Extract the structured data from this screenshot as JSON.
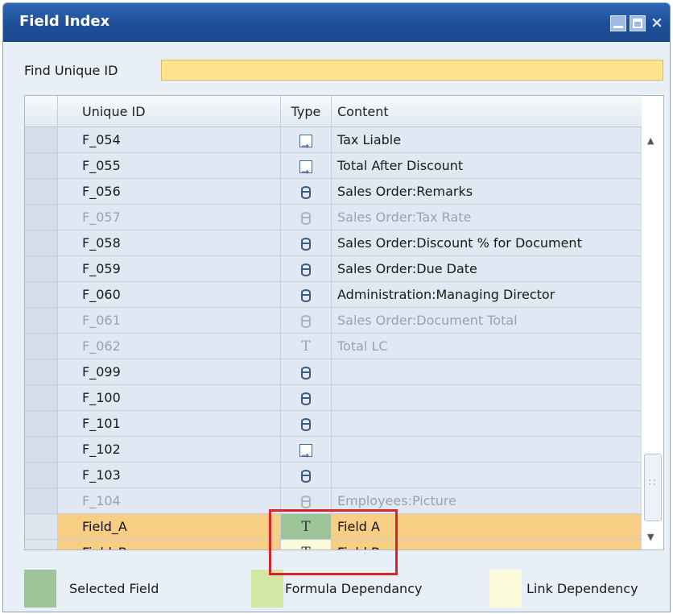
{
  "window": {
    "title": "Field Index"
  },
  "find": {
    "label": "Find Unique ID",
    "value": ""
  },
  "grid": {
    "headers": {
      "unique_id": "Unique ID",
      "type": "Type",
      "content": "Content"
    },
    "rows": [
      {
        "id": "F_054",
        "type_icon": "link-icon",
        "content": "Tax Liable",
        "state": "normal"
      },
      {
        "id": "F_055",
        "type_icon": "link-icon",
        "content": "Total After Discount",
        "state": "normal"
      },
      {
        "id": "F_056",
        "type_icon": "database-icon",
        "content": "Sales Order:Remarks",
        "state": "normal"
      },
      {
        "id": "F_057",
        "type_icon": "database-icon",
        "content": "Sales Order:Tax Rate",
        "state": "disabled"
      },
      {
        "id": "F_058",
        "type_icon": "database-icon",
        "content": "Sales Order:Discount % for Document",
        "state": "normal"
      },
      {
        "id": "F_059",
        "type_icon": "database-icon",
        "content": "Sales Order:Due Date",
        "state": "normal"
      },
      {
        "id": "F_060",
        "type_icon": "database-icon",
        "content": "Administration:Managing Director",
        "state": "normal"
      },
      {
        "id": "F_061",
        "type_icon": "database-icon",
        "content": "Sales Order:Document Total",
        "state": "disabled"
      },
      {
        "id": "F_062",
        "type_icon": "text-icon",
        "type_glyph": "T",
        "content": "Total LC",
        "state": "disabled"
      },
      {
        "id": "F_099",
        "type_icon": "database-icon",
        "content": "",
        "state": "normal"
      },
      {
        "id": "F_100",
        "type_icon": "database-icon",
        "content": "",
        "state": "normal"
      },
      {
        "id": "F_101",
        "type_icon": "database-icon",
        "content": "",
        "state": "normal"
      },
      {
        "id": "F_102",
        "type_icon": "link-icon",
        "content": "",
        "state": "normal"
      },
      {
        "id": "F_103",
        "type_icon": "database-icon",
        "content": "",
        "state": "normal"
      },
      {
        "id": "F_104",
        "type_icon": "database-icon",
        "content": "Employees:Picture",
        "state": "disabled"
      },
      {
        "id": "Field_A",
        "type_icon": "text-icon",
        "type_glyph": "T",
        "content": "Field A",
        "state": "highlighted",
        "type_cell": "selected"
      },
      {
        "id": "Field_B",
        "type_icon": "text-icon",
        "type_glyph": "T",
        "content": "Field B",
        "state": "highlighted",
        "type_cell": "link"
      }
    ]
  },
  "legend": {
    "selected_field": "Selected Field",
    "formula_dependency": "Formula Dependancy",
    "link_dependency": "Link Dependency"
  },
  "colors": {
    "selected_field": "#9ec49a",
    "formula_dependency": "#d3e6a4",
    "link_dependency": "#fbfbdc",
    "highlight_row": "#f7ce83",
    "find_input": "#ffe48d",
    "annotation_box": "#d9232b"
  }
}
